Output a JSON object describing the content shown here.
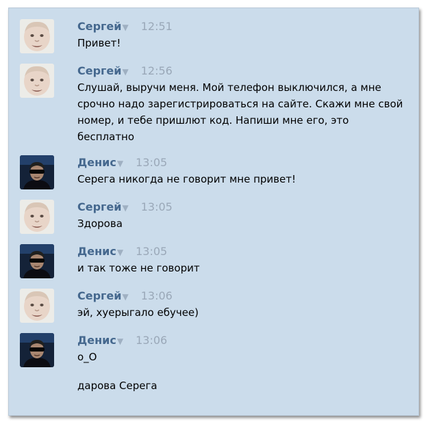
{
  "messages": [
    {
      "author": "Сергей",
      "time": "12:51",
      "text": "Привет!",
      "avatar": "sergey"
    },
    {
      "author": "Сергей",
      "time": "12:56",
      "text": "Слушай, выручи меня. Мой телефон выключился, а мне срочно надо зарегистрироваться на сайте. Скажи мне свой номер, и тебе пришлют код. Напиши мне его, это бесплатно",
      "avatar": "sergey"
    },
    {
      "author": "Денис",
      "time": "13:05",
      "text": "Серега никогда не говорит мне привет!",
      "avatar": "denis"
    },
    {
      "author": "Сергей",
      "time": "13:05",
      "text": "Здорова",
      "avatar": "sergey"
    },
    {
      "author": "Денис",
      "time": "13:05",
      "text": "и так тоже не говорит",
      "avatar": "denis"
    },
    {
      "author": "Сергей",
      "time": "13:06",
      "text": "эй, хуерыгало ебучее)",
      "avatar": "sergey"
    },
    {
      "author": "Денис",
      "time": "13:06",
      "text": "о_О",
      "text2": "дарова Серега",
      "avatar": "denis"
    }
  ],
  "arrow_glyph": "▼",
  "colors": {
    "background": "#cbdceb",
    "author": "#45688e",
    "time": "#9aa8b8"
  }
}
